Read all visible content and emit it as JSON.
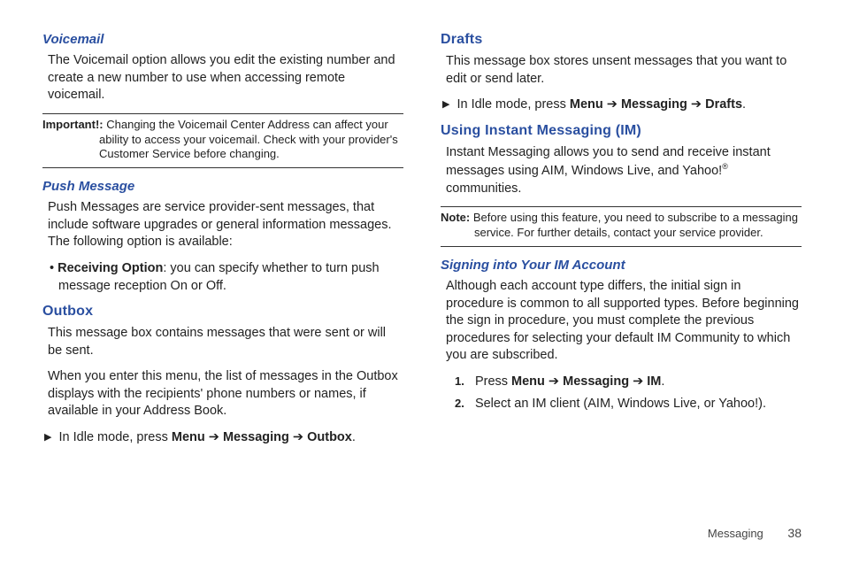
{
  "left": {
    "voicemail": {
      "title": "Voicemail",
      "body": "The Voicemail option allows you edit the existing number and create a new number to use when accessing remote voicemail."
    },
    "important": {
      "label": "Important!:",
      "text": "Changing the Voicemail Center Address can affect your ability to access your voicemail. Check with your provider's Customer Service before changing."
    },
    "push": {
      "title": "Push Message",
      "body": "Push Messages are service provider-sent messages, that include software upgrades or general information messages. The following option is available:",
      "bullet_label": "Receiving Option",
      "bullet_rest": ": you can specify whether to turn push message reception On or Off."
    },
    "outbox": {
      "title": "Outbox",
      "p1": "This message box contains messages that were sent or will be sent.",
      "p2": "When you enter this menu, the list of messages in the Outbox displays with the recipients' phone numbers or names, if available in your Address Book.",
      "step_prefix": "In Idle mode, press ",
      "menu": "Menu",
      "messaging": "Messaging",
      "outbox": "Outbox"
    }
  },
  "right": {
    "drafts": {
      "title": "Drafts",
      "body": "This message box stores unsent messages that you want to edit or send later.",
      "step_prefix": "In Idle mode, press ",
      "menu": "Menu",
      "messaging": "Messaging",
      "drafts": "Drafts"
    },
    "im": {
      "title": "Using Instant Messaging (IM)",
      "body_a": "Instant Messaging allows you to send and receive instant messages using AIM, Windows Live, and Yahoo!",
      "body_b": " communities."
    },
    "note": {
      "label": "Note:",
      "text": "Before using this feature, you need to subscribe to a messaging service. For further details, contact your service provider."
    },
    "signin": {
      "title": "Signing into Your IM Account",
      "body": "Although each account type differs, the initial sign in procedure is common to all supported types. Before beginning the sign in procedure, you must complete the previous procedures for selecting your default IM Community to which you are subscribed.",
      "step1_prefix": "Press ",
      "menu": "Menu",
      "messaging": "Messaging",
      "im_label": "IM",
      "step2": "Select an IM client (AIM, Windows Live, or Yahoo!)."
    }
  },
  "footer": {
    "section": "Messaging",
    "page": "38"
  },
  "sym": {
    "arrow": "➔",
    "tri": "▶",
    "dot": "•",
    "reg": "®"
  }
}
